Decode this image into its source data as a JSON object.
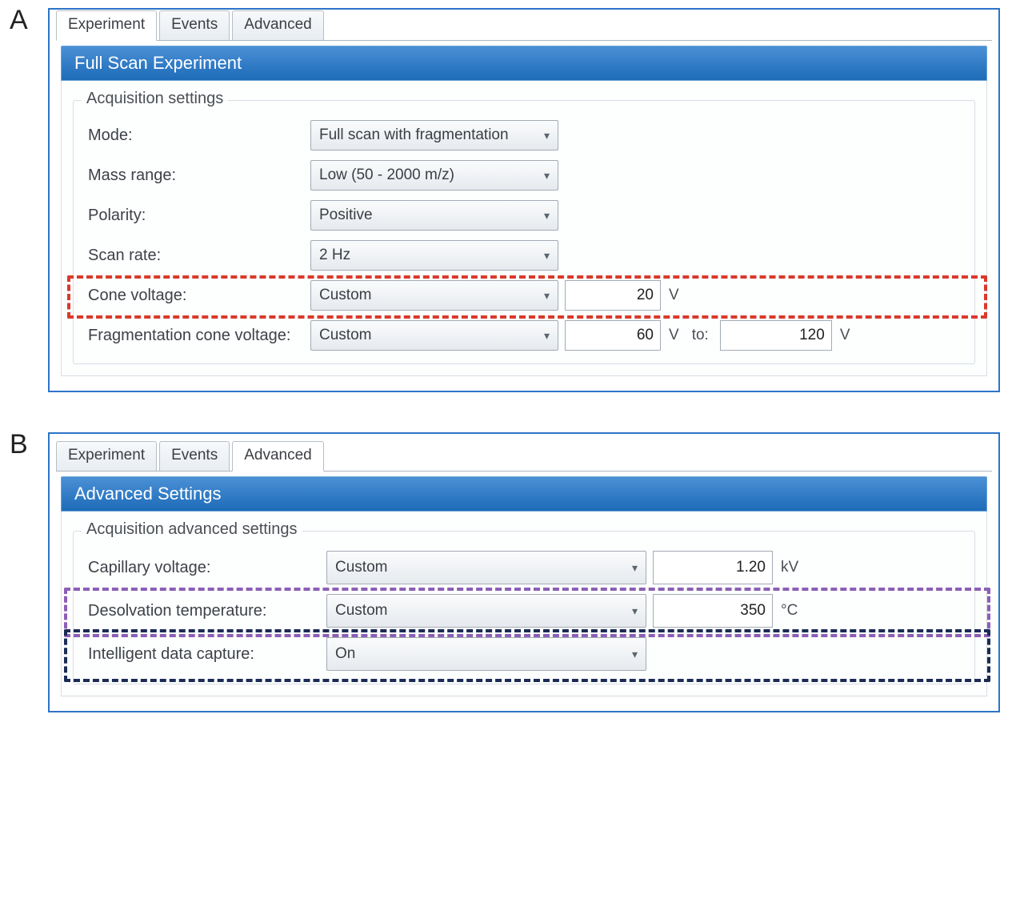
{
  "panelA": {
    "label": "A",
    "tabs": [
      "Experiment",
      "Events",
      "Advanced"
    ],
    "activeTab": 0,
    "sectionTitle": "Full Scan Experiment",
    "groupTitle": "Acquisition settings",
    "rows": {
      "mode": {
        "label": "Mode:",
        "value": "Full scan with fragmentation"
      },
      "massRange": {
        "label": "Mass range:",
        "value": "Low (50 - 2000 m/z)"
      },
      "polarity": {
        "label": "Polarity:",
        "value": "Positive"
      },
      "scanRate": {
        "label": "Scan rate:",
        "value": "2 Hz"
      },
      "coneVoltage": {
        "label": "Cone voltage:",
        "value": "Custom",
        "num": "20",
        "unit": "V"
      },
      "fragCone": {
        "label": "Fragmentation cone voltage:",
        "value": "Custom",
        "from": "60",
        "to": "120",
        "unit": "V",
        "toLabel": "to:"
      }
    },
    "highlight": {
      "color": "#d93a2b"
    }
  },
  "panelB": {
    "label": "B",
    "tabs": [
      "Experiment",
      "Events",
      "Advanced"
    ],
    "activeTab": 2,
    "sectionTitle": "Advanced Settings",
    "groupTitle": "Acquisition advanced settings",
    "rows": {
      "capVoltage": {
        "label": "Capillary voltage:",
        "value": "Custom",
        "num": "1.20",
        "unit": "kV"
      },
      "desolvTemp": {
        "label": "Desolvation temperature:",
        "value": "Custom",
        "num": "350",
        "unit": "°C"
      },
      "idc": {
        "label": "Intelligent data capture:",
        "value": "On"
      }
    },
    "highlights": [
      {
        "color": "#8c5fb5"
      },
      {
        "color": "#1b2b55"
      }
    ]
  }
}
